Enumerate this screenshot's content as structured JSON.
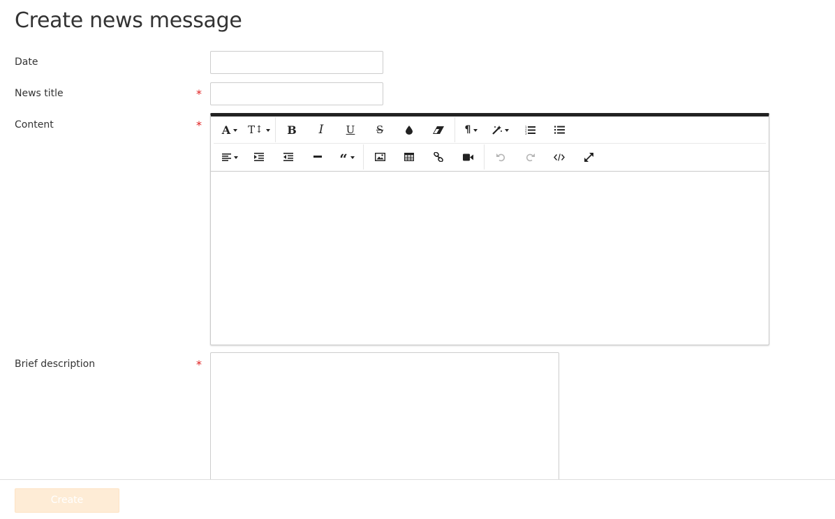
{
  "page": {
    "title": "Create news message"
  },
  "form": {
    "date": {
      "label": "Date",
      "value": "",
      "placeholder": ""
    },
    "news_title": {
      "label": "News title",
      "required_mark": "*",
      "value": "",
      "placeholder": ""
    },
    "content": {
      "label": "Content",
      "required_mark": "*",
      "toolbar": {
        "row1": [
          [
            "font-name-icon",
            "font-size-icon"
          ],
          [
            "bold-icon",
            "italic-icon",
            "underline-icon",
            "strikethrough-icon",
            "color-drop-icon",
            "eraser-icon"
          ],
          [
            "paragraph-icon",
            "magic-style-icon",
            "ordered-list-icon",
            "unordered-list-icon"
          ]
        ],
        "row2": [
          [
            "align-icon",
            "indent-icon",
            "outdent-icon",
            "horizontal-rule-icon",
            "quote-icon"
          ],
          [
            "image-icon",
            "table-icon",
            "link-icon",
            "video-icon"
          ],
          [
            "undo-icon",
            "redo-icon",
            "code-view-icon",
            "fullscreen-icon"
          ]
        ],
        "disabled": [
          "undo-icon",
          "redo-icon"
        ]
      }
    },
    "brief_description": {
      "label": "Brief description",
      "required_mark": "*",
      "value": ""
    }
  },
  "footer": {
    "create_label": "Create",
    "create_enabled": false
  },
  "colors": {
    "required": "#e02020",
    "editor_top_bar": "#222222",
    "create_button_bg": "#feecd6"
  }
}
